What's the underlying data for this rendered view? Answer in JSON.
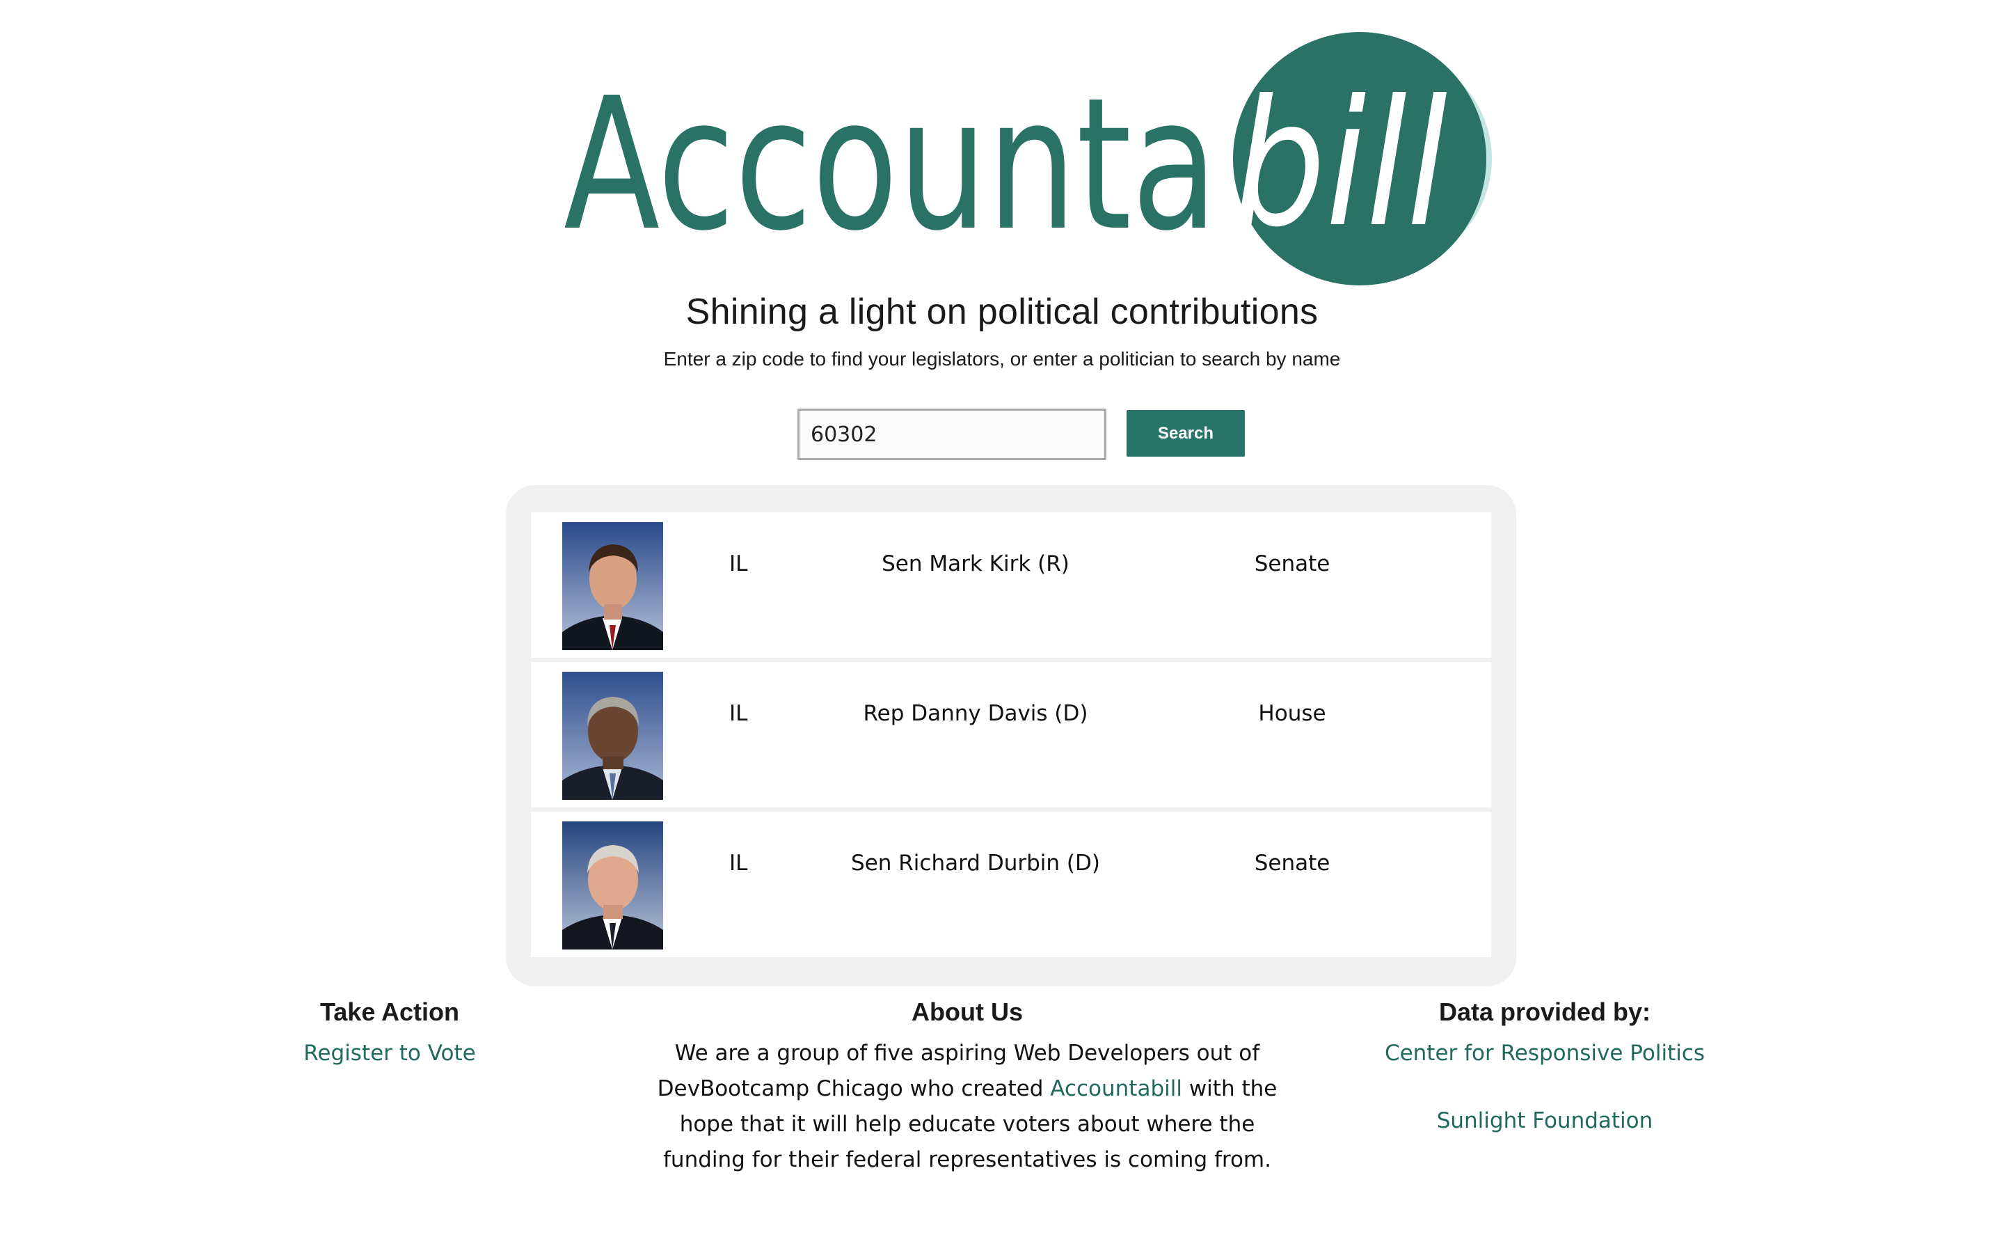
{
  "logo": {
    "text_main": "Accounta",
    "text_circle": "bill",
    "colors": {
      "brand": "#2a7166",
      "circle_shadow": "#c4e4e2",
      "circle_text": "#ffffff"
    }
  },
  "tagline": {
    "main": "Shining a light on political contributions",
    "sub": "Enter a zip code to find your legislators, or enter a politician to search by name"
  },
  "search": {
    "value": "60302",
    "button_label": "Search"
  },
  "results": [
    {
      "state": "IL",
      "name": "Sen Mark Kirk (R)",
      "chamber": "Senate"
    },
    {
      "state": "IL",
      "name": "Rep Danny Davis (D)",
      "chamber": "House"
    },
    {
      "state": "IL",
      "name": "Sen Richard Durbin (D)",
      "chamber": "Senate"
    }
  ],
  "footer": {
    "take_action": {
      "heading": "Take Action",
      "link": "Register to Vote"
    },
    "about": {
      "heading": "About Us",
      "text_before": "We are a group of five aspiring Web Developers out of DevBootcamp Chicago who created ",
      "link": "Accountabill",
      "text_after": " with the hope that it will help educate voters about where the funding for their federal representatives is coming from."
    },
    "data": {
      "heading": "Data provided by:",
      "links": [
        "Center for Responsive Politics",
        "Sunlight Foundation"
      ]
    }
  },
  "colors": {
    "accent": "#26746a",
    "link": "#21695f",
    "panel_bg": "#f1f0f0"
  }
}
